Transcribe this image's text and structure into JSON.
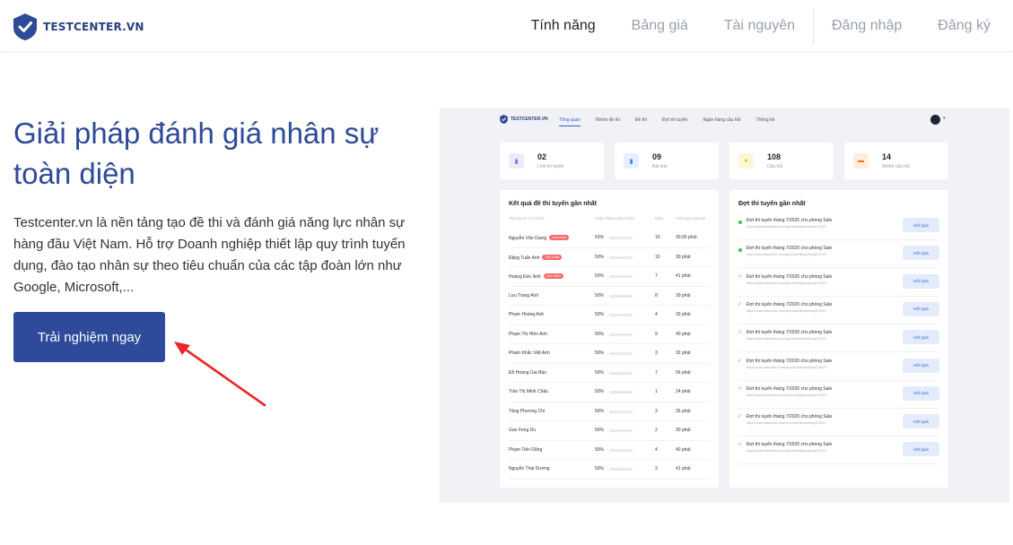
{
  "brand": {
    "name": "TESTCENTER.VN",
    "color": "#2e4a98"
  },
  "nav": {
    "items": [
      {
        "label": "Tính năng",
        "active": true
      },
      {
        "label": "Bảng giá",
        "active": false
      },
      {
        "label": "Tài nguyên",
        "active": false
      }
    ],
    "login": "Đăng nhập",
    "register": "Đăng ký"
  },
  "hero": {
    "title": "Giải pháp đánh giá nhân sự toàn diện",
    "description": "Testcenter.vn là nền tảng tạo đề thi và đánh giá năng lực nhân sự hàng đầu Việt Nam. Hỗ trợ Doanh nghiệp thiết lập quy trình tuyển dụng, đào tạo nhân sự theo tiêu chuẩn của các tập đoàn lớn như Google, Microsoft,...",
    "cta": "Trải nghiệm ngay"
  },
  "dashboard": {
    "brand": "TESTCENTER.VN",
    "nav": [
      "Tổng quan",
      "Nhóm đề thi",
      "Đề thi",
      "Đợt thi tuyển",
      "Ngân hàng câu hỏi",
      "Thống kê"
    ],
    "stats": [
      {
        "value": "02",
        "label": "Link thi tuyển",
        "icon": "link-icon",
        "color": "#8b5cf6",
        "bg": "#efe9fd"
      },
      {
        "value": "09",
        "label": "Bài test",
        "icon": "document-icon",
        "color": "#3b82f6",
        "bg": "#e6efff"
      },
      {
        "value": "108",
        "label": "Câu hỏi",
        "icon": "question-icon",
        "color": "#f5c400",
        "bg": "#fff6d6"
      },
      {
        "value": "14",
        "label": "Nhóm câu hỏi",
        "icon": "folder-icon",
        "color": "#f97316",
        "bg": "#ffeede"
      }
    ],
    "results": {
      "title": "Kết quả đề thi tuyển gần nhất",
      "columns": [
        "TÊN NGƯỜI THI TUYỂN",
        "PHẦN TRĂM HOÀN THÀNH",
        "ĐIỂM",
        "THỜI GIAN LÀM BÀI"
      ],
      "rows": [
        {
          "name": "Nguyễn Văn Giang",
          "tag": "Cần chấm",
          "percent": "53%",
          "fill": 0.53,
          "score": "10",
          "time": "30:00 phút"
        },
        {
          "name": "Đặng Tuấn Anh",
          "tag": "Cần chấm",
          "percent": "50%",
          "fill": 0.5,
          "score": "10",
          "time": "30 phút"
        },
        {
          "name": "Hoàng Đức Anh",
          "tag": "Cần chấm",
          "percent": "50%",
          "fill": 0.5,
          "score": "7",
          "time": "41 phút"
        },
        {
          "name": "Lưu Trang Anh",
          "tag": "",
          "percent": "50%",
          "fill": 0.5,
          "score": "8",
          "time": "30 phút"
        },
        {
          "name": "Phạm Hoàng Anh",
          "tag": "",
          "percent": "50%",
          "fill": 0.5,
          "score": "4",
          "time": "33 phút"
        },
        {
          "name": "Phạm Thị Hiền Anh",
          "tag": "",
          "percent": "50%",
          "fill": 0.5,
          "score": "9",
          "time": "40 phút"
        },
        {
          "name": "Phạm Khắc Việt Anh",
          "tag": "",
          "percent": "50%",
          "fill": 0.5,
          "score": "3",
          "time": "32 phút"
        },
        {
          "name": "Đỗ Hoàng Gia Bảo",
          "tag": "",
          "percent": "50%",
          "fill": 0.5,
          "score": "7",
          "time": "56 phút"
        },
        {
          "name": "Trần Thị Minh Châu",
          "tag": "",
          "percent": "50%",
          "fill": 0.5,
          "score": "1",
          "time": "24 phút"
        },
        {
          "name": "Tăng Phương Chi",
          "tag": "",
          "percent": "50%",
          "fill": 0.5,
          "score": "3",
          "time": "25 phút"
        },
        {
          "name": "Gan Feng Du",
          "tag": "",
          "percent": "50%",
          "fill": 0.5,
          "score": "2",
          "time": "30 phút"
        },
        {
          "name": "Phạm Tiến Dũng",
          "tag": "",
          "percent": "50%",
          "fill": 0.5,
          "score": "4",
          "time": "40 phút"
        },
        {
          "name": "Nguyễn Thái Dương",
          "tag": "",
          "percent": "50%",
          "fill": 0.5,
          "score": "3",
          "time": "41 phút"
        }
      ]
    },
    "events": {
      "title": "Đợt thi tuyển gần nhất",
      "button": "Kết Quả",
      "items": [
        {
          "title": "Đợt thi tuyển tháng 7/2020  cho phòng Sale",
          "url": "https://www.testcenter.com/topcv/dotthituyenthang7/2020",
          "status": "dot"
        },
        {
          "title": "Đợt thi tuyển tháng 7/2020  cho phòng Sale",
          "url": "https://www.testcenter.com/topcv/dotthituyenthang7/2020",
          "status": "dot"
        },
        {
          "title": "Đợt thi tuyển tháng 7/2020  cho phòng Sale",
          "url": "https://www.testcenter.com/topcv/dotthituyenthang7/2020",
          "status": "check"
        },
        {
          "title": "Đợt thi tuyển tháng 7/2020  cho phòng Sale",
          "url": "https://www.testcenter.com/topcv/dotthituyenthang7/2020",
          "status": "check"
        },
        {
          "title": "Đợt thi tuyển tháng 7/2020  cho phòng Sale",
          "url": "https://www.testcenter.com/topcv/dotthituyenthang7/2020",
          "status": "check"
        },
        {
          "title": "Đợt thi tuyển tháng 7/2020  cho phòng Sale",
          "url": "https://www.testcenter.com/topcv/dotthituyenthang7/2020",
          "status": "check"
        },
        {
          "title": "Đợt thi tuyển tháng 7/2020  cho phòng Sale",
          "url": "https://www.testcenter.com/topcv/dotthituyenthang7/2020",
          "status": "check"
        },
        {
          "title": "Đợt thi tuyển tháng 7/2020  cho phòng Sale",
          "url": "https://www.testcenter.com/topcv/dotthituyenthang7/2020",
          "status": "check"
        },
        {
          "title": "Đợt thi tuyển tháng 7/2020  cho phòng Sale",
          "url": "https://www.testcenter.com/topcv/dotthituyenthang7/2020",
          "status": "check"
        }
      ]
    }
  },
  "annotation": {
    "icon": "red-arrow-icon",
    "color": "#e8262a"
  }
}
